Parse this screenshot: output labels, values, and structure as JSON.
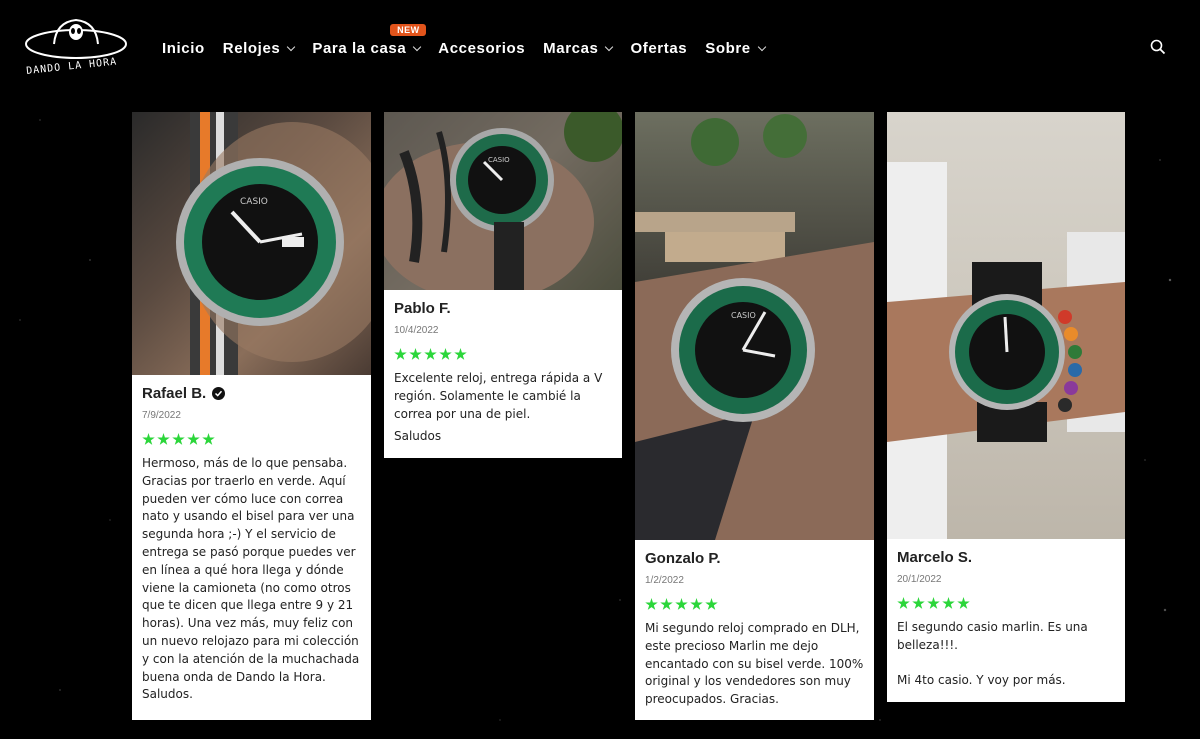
{
  "brand": {
    "name": "DANDO LA HORA"
  },
  "nav": [
    {
      "label": "Inicio",
      "has_menu": false
    },
    {
      "label": "Relojes",
      "has_menu": true
    },
    {
      "label": "Para la casa",
      "has_menu": true,
      "badge": "NEW"
    },
    {
      "label": "Accesorios",
      "has_menu": false
    },
    {
      "label": "Marcas",
      "has_menu": true
    },
    {
      "label": "Ofertas",
      "has_menu": false
    },
    {
      "label": "Sobre",
      "has_menu": true
    }
  ],
  "icons": {
    "search": "search-icon",
    "verified": "check-circle-icon",
    "chevron": "chevron-down-icon"
  },
  "colors": {
    "stars": "#2bd63a",
    "badge": "#e2541b",
    "background": "#000000"
  },
  "reviews": [
    {
      "name": "Rafael B.",
      "verified": true,
      "date": "7/9/2022",
      "rating": 5,
      "text": "Hermoso, más de lo que pensaba. Gracias por traerlo en verde. Aquí pueden ver cómo luce con correa nato y usando el bisel para ver una segunda hora ;-) Y el servicio de entrega se pasó porque puedes ver en línea a qué hora llega y dónde viene la camioneta (no como otros que te dicen que llega entre 9 y 21 horas). Una vez más, muy feliz con un nuevo relojazo para mi colección y con la atención de la muchachada buena onda de Dando la Hora. Saludos."
    },
    {
      "name": "Pablo F.",
      "verified": false,
      "date": "10/4/2022",
      "rating": 5,
      "text": "Excelente reloj, entrega rápida a V región. Solamente le cambié la correa por una de piel.",
      "extra": "Saludos"
    },
    {
      "name": "Gonzalo P.",
      "verified": false,
      "date": "1/2/2022",
      "rating": 5,
      "text": "Mi segundo reloj comprado en DLH, este precioso Marlin me dejo encantado con su bisel verde. 100% original y los vendedores son muy preocupados. Gracias."
    },
    {
      "name": "Marcelo S.",
      "verified": false,
      "date": "20/1/2022",
      "rating": 5,
      "text": "El segundo casio marlin. Es una belleza!!!.\n\nMi 4to casio. Y voy por más."
    }
  ]
}
